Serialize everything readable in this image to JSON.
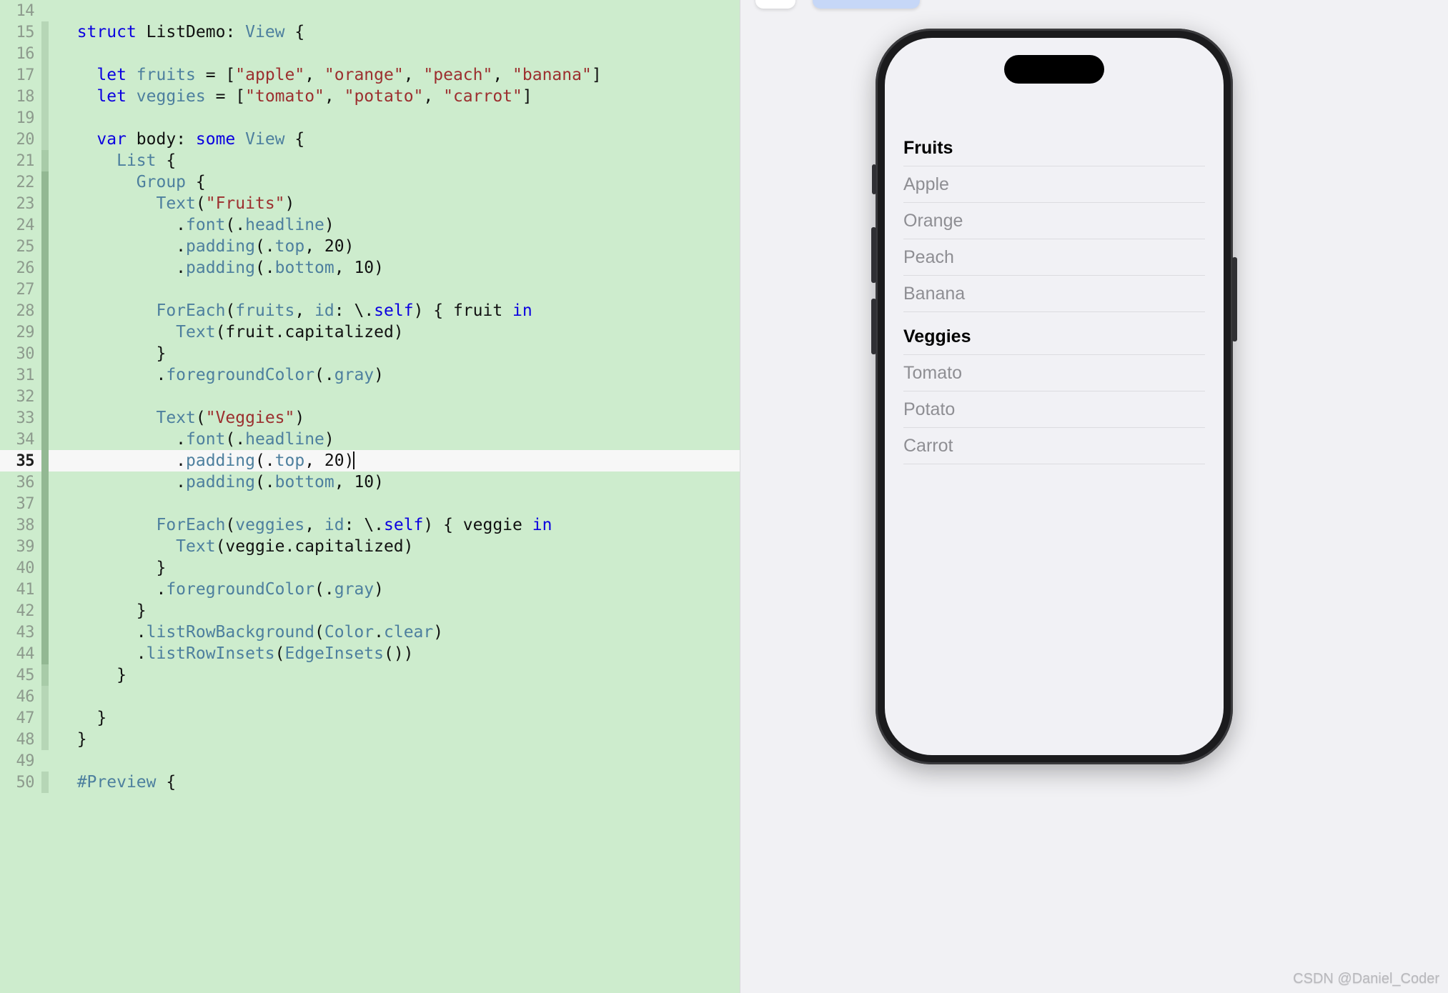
{
  "editor": {
    "language": "swift",
    "first_visible_line": 14,
    "active_line": 35,
    "cursor_after": "20)",
    "colors": {
      "background": "#cdeccd",
      "active_line_background": "#f7f7f7",
      "keyword": "#0b00e0",
      "type": "#4d7f9e",
      "string": "#9c2f2f",
      "plain": "#111111",
      "gutter_text": "#8d9a8d"
    },
    "lines": [
      {
        "n": 14,
        "guide": 0,
        "tokens": []
      },
      {
        "n": 15,
        "guide": 1,
        "tokens": [
          {
            "t": "  ",
            "c": "pln"
          },
          {
            "t": "struct",
            "c": "kw"
          },
          {
            "t": " ",
            "c": "pln"
          },
          {
            "t": "ListDemo",
            "c": "pln"
          },
          {
            "t": ": ",
            "c": "pln"
          },
          {
            "t": "View",
            "c": "typ"
          },
          {
            "t": " {",
            "c": "pln"
          }
        ]
      },
      {
        "n": 16,
        "guide": 1,
        "tokens": []
      },
      {
        "n": 17,
        "guide": 1,
        "tokens": [
          {
            "t": "    ",
            "c": "pln"
          },
          {
            "t": "let",
            "c": "kw"
          },
          {
            "t": " ",
            "c": "pln"
          },
          {
            "t": "fruits",
            "c": "typ"
          },
          {
            "t": " = [",
            "c": "pln"
          },
          {
            "t": "\"apple\"",
            "c": "str"
          },
          {
            "t": ", ",
            "c": "pln"
          },
          {
            "t": "\"orange\"",
            "c": "str"
          },
          {
            "t": ", ",
            "c": "pln"
          },
          {
            "t": "\"peach\"",
            "c": "str"
          },
          {
            "t": ", ",
            "c": "pln"
          },
          {
            "t": "\"banana\"",
            "c": "str"
          },
          {
            "t": "]",
            "c": "pln"
          }
        ]
      },
      {
        "n": 18,
        "guide": 1,
        "tokens": [
          {
            "t": "    ",
            "c": "pln"
          },
          {
            "t": "let",
            "c": "kw"
          },
          {
            "t": " ",
            "c": "pln"
          },
          {
            "t": "veggies",
            "c": "typ"
          },
          {
            "t": " = [",
            "c": "pln"
          },
          {
            "t": "\"tomato\"",
            "c": "str"
          },
          {
            "t": ", ",
            "c": "pln"
          },
          {
            "t": "\"potato\"",
            "c": "str"
          },
          {
            "t": ", ",
            "c": "pln"
          },
          {
            "t": "\"carrot\"",
            "c": "str"
          },
          {
            "t": "]",
            "c": "pln"
          }
        ]
      },
      {
        "n": 19,
        "guide": 1,
        "tokens": []
      },
      {
        "n": 20,
        "guide": 1,
        "tokens": [
          {
            "t": "    ",
            "c": "pln"
          },
          {
            "t": "var",
            "c": "kw"
          },
          {
            "t": " ",
            "c": "pln"
          },
          {
            "t": "body",
            "c": "pln"
          },
          {
            "t": ": ",
            "c": "pln"
          },
          {
            "t": "some",
            "c": "kw"
          },
          {
            "t": " ",
            "c": "pln"
          },
          {
            "t": "View",
            "c": "typ"
          },
          {
            "t": " {",
            "c": "pln"
          }
        ]
      },
      {
        "n": 21,
        "guide": 2,
        "tokens": [
          {
            "t": "      ",
            "c": "pln"
          },
          {
            "t": "List",
            "c": "typ"
          },
          {
            "t": " {",
            "c": "pln"
          }
        ]
      },
      {
        "n": 22,
        "guide": 3,
        "tokens": [
          {
            "t": "        ",
            "c": "pln"
          },
          {
            "t": "Group",
            "c": "typ"
          },
          {
            "t": " {",
            "c": "pln"
          }
        ]
      },
      {
        "n": 23,
        "guide": 3,
        "tokens": [
          {
            "t": "          ",
            "c": "pln"
          },
          {
            "t": "Text",
            "c": "typ"
          },
          {
            "t": "(",
            "c": "pln"
          },
          {
            "t": "\"Fruits\"",
            "c": "str"
          },
          {
            "t": ")",
            "c": "pln"
          }
        ]
      },
      {
        "n": 24,
        "guide": 3,
        "tokens": [
          {
            "t": "            .",
            "c": "pln"
          },
          {
            "t": "font",
            "c": "typ"
          },
          {
            "t": "(.",
            "c": "pln"
          },
          {
            "t": "headline",
            "c": "typ"
          },
          {
            "t": ")",
            "c": "pln"
          }
        ]
      },
      {
        "n": 25,
        "guide": 3,
        "tokens": [
          {
            "t": "            .",
            "c": "pln"
          },
          {
            "t": "padding",
            "c": "typ"
          },
          {
            "t": "(.",
            "c": "pln"
          },
          {
            "t": "top",
            "c": "typ"
          },
          {
            "t": ", 20)",
            "c": "pln"
          }
        ]
      },
      {
        "n": 26,
        "guide": 3,
        "tokens": [
          {
            "t": "            .",
            "c": "pln"
          },
          {
            "t": "padding",
            "c": "typ"
          },
          {
            "t": "(.",
            "c": "pln"
          },
          {
            "t": "bottom",
            "c": "typ"
          },
          {
            "t": ", 10)",
            "c": "pln"
          }
        ]
      },
      {
        "n": 27,
        "guide": 3,
        "tokens": []
      },
      {
        "n": 28,
        "guide": 3,
        "tokens": [
          {
            "t": "          ",
            "c": "pln"
          },
          {
            "t": "ForEach",
            "c": "typ"
          },
          {
            "t": "(",
            "c": "pln"
          },
          {
            "t": "fruits",
            "c": "typ"
          },
          {
            "t": ", ",
            "c": "pln"
          },
          {
            "t": "id",
            "c": "typ"
          },
          {
            "t": ": \\.",
            "c": "pln"
          },
          {
            "t": "self",
            "c": "kw"
          },
          {
            "t": ") { fruit ",
            "c": "pln"
          },
          {
            "t": "in",
            "c": "kw"
          }
        ]
      },
      {
        "n": 29,
        "guide": 3,
        "tokens": [
          {
            "t": "            ",
            "c": "pln"
          },
          {
            "t": "Text",
            "c": "typ"
          },
          {
            "t": "(fruit.capitalized)",
            "c": "pln"
          }
        ]
      },
      {
        "n": 30,
        "guide": 3,
        "tokens": [
          {
            "t": "          }",
            "c": "pln"
          }
        ]
      },
      {
        "n": 31,
        "guide": 3,
        "tokens": [
          {
            "t": "          .",
            "c": "pln"
          },
          {
            "t": "foregroundColor",
            "c": "typ"
          },
          {
            "t": "(.",
            "c": "pln"
          },
          {
            "t": "gray",
            "c": "typ"
          },
          {
            "t": ")",
            "c": "pln"
          }
        ]
      },
      {
        "n": 32,
        "guide": 3,
        "tokens": []
      },
      {
        "n": 33,
        "guide": 3,
        "tokens": [
          {
            "t": "          ",
            "c": "pln"
          },
          {
            "t": "Text",
            "c": "typ"
          },
          {
            "t": "(",
            "c": "pln"
          },
          {
            "t": "\"Veggies\"",
            "c": "str"
          },
          {
            "t": ")",
            "c": "pln"
          }
        ]
      },
      {
        "n": 34,
        "guide": 3,
        "tokens": [
          {
            "t": "            .",
            "c": "pln"
          },
          {
            "t": "font",
            "c": "typ"
          },
          {
            "t": "(.",
            "c": "pln"
          },
          {
            "t": "headline",
            "c": "typ"
          },
          {
            "t": ")",
            "c": "pln"
          }
        ]
      },
      {
        "n": 35,
        "guide": 3,
        "active": true,
        "tokens": [
          {
            "t": "            .",
            "c": "pln"
          },
          {
            "t": "padding",
            "c": "typ"
          },
          {
            "t": "(.",
            "c": "pln"
          },
          {
            "t": "top",
            "c": "typ"
          },
          {
            "t": ", 20)",
            "c": "pln"
          }
        ]
      },
      {
        "n": 36,
        "guide": 3,
        "tokens": [
          {
            "t": "            .",
            "c": "pln"
          },
          {
            "t": "padding",
            "c": "typ"
          },
          {
            "t": "(.",
            "c": "pln"
          },
          {
            "t": "bottom",
            "c": "typ"
          },
          {
            "t": ", 10)",
            "c": "pln"
          }
        ]
      },
      {
        "n": 37,
        "guide": 3,
        "tokens": []
      },
      {
        "n": 38,
        "guide": 3,
        "tokens": [
          {
            "t": "          ",
            "c": "pln"
          },
          {
            "t": "ForEach",
            "c": "typ"
          },
          {
            "t": "(",
            "c": "pln"
          },
          {
            "t": "veggies",
            "c": "typ"
          },
          {
            "t": ", ",
            "c": "pln"
          },
          {
            "t": "id",
            "c": "typ"
          },
          {
            "t": ": \\.",
            "c": "pln"
          },
          {
            "t": "self",
            "c": "kw"
          },
          {
            "t": ") { veggie ",
            "c": "pln"
          },
          {
            "t": "in",
            "c": "kw"
          }
        ]
      },
      {
        "n": 39,
        "guide": 3,
        "tokens": [
          {
            "t": "            ",
            "c": "pln"
          },
          {
            "t": "Text",
            "c": "typ"
          },
          {
            "t": "(veggie.capitalized)",
            "c": "pln"
          }
        ]
      },
      {
        "n": 40,
        "guide": 3,
        "tokens": [
          {
            "t": "          }",
            "c": "pln"
          }
        ]
      },
      {
        "n": 41,
        "guide": 3,
        "tokens": [
          {
            "t": "          .",
            "c": "pln"
          },
          {
            "t": "foregroundColor",
            "c": "typ"
          },
          {
            "t": "(.",
            "c": "pln"
          },
          {
            "t": "gray",
            "c": "typ"
          },
          {
            "t": ")",
            "c": "pln"
          }
        ]
      },
      {
        "n": 42,
        "guide": 3,
        "tokens": [
          {
            "t": "        }",
            "c": "pln"
          }
        ]
      },
      {
        "n": 43,
        "guide": 3,
        "tokens": [
          {
            "t": "        .",
            "c": "pln"
          },
          {
            "t": "listRowBackground",
            "c": "typ"
          },
          {
            "t": "(",
            "c": "pln"
          },
          {
            "t": "Color",
            "c": "typ"
          },
          {
            "t": ".",
            "c": "pln"
          },
          {
            "t": "clear",
            "c": "typ"
          },
          {
            "t": ")",
            "c": "pln"
          }
        ]
      },
      {
        "n": 44,
        "guide": 3,
        "tokens": [
          {
            "t": "        .",
            "c": "pln"
          },
          {
            "t": "listRowInsets",
            "c": "typ"
          },
          {
            "t": "(",
            "c": "pln"
          },
          {
            "t": "EdgeInsets",
            "c": "typ"
          },
          {
            "t": "())",
            "c": "pln"
          }
        ]
      },
      {
        "n": 45,
        "guide": 2,
        "tokens": [
          {
            "t": "      }",
            "c": "pln"
          }
        ]
      },
      {
        "n": 46,
        "guide": 1,
        "tokens": []
      },
      {
        "n": 47,
        "guide": 1,
        "tokens": [
          {
            "t": "    }",
            "c": "pln"
          }
        ]
      },
      {
        "n": 48,
        "guide": 1,
        "tokens": [
          {
            "t": "  }",
            "c": "pln"
          }
        ]
      },
      {
        "n": 49,
        "guide": 0,
        "tokens": []
      },
      {
        "n": 50,
        "guide": 1,
        "tokens": [
          {
            "t": "  ",
            "c": "pln"
          },
          {
            "t": "#Preview",
            "c": "typ"
          },
          {
            "t": " {",
            "c": "pln"
          }
        ]
      }
    ]
  },
  "preview": {
    "toolbar": {
      "canvas_chip_label": "",
      "preview_chip_label": ""
    },
    "device": {
      "name": "iPhone",
      "island": "dynamic-island",
      "buttons": [
        "silent-switch",
        "volume-up",
        "volume-down",
        "power"
      ]
    },
    "list": {
      "sections": [
        {
          "header": "Fruits",
          "items": [
            "Apple",
            "Orange",
            "Peach",
            "Banana"
          ]
        },
        {
          "header": "Veggies",
          "items": [
            "Tomato",
            "Potato",
            "Carrot"
          ]
        }
      ]
    }
  },
  "watermark": "CSDN @Daniel_Coder"
}
